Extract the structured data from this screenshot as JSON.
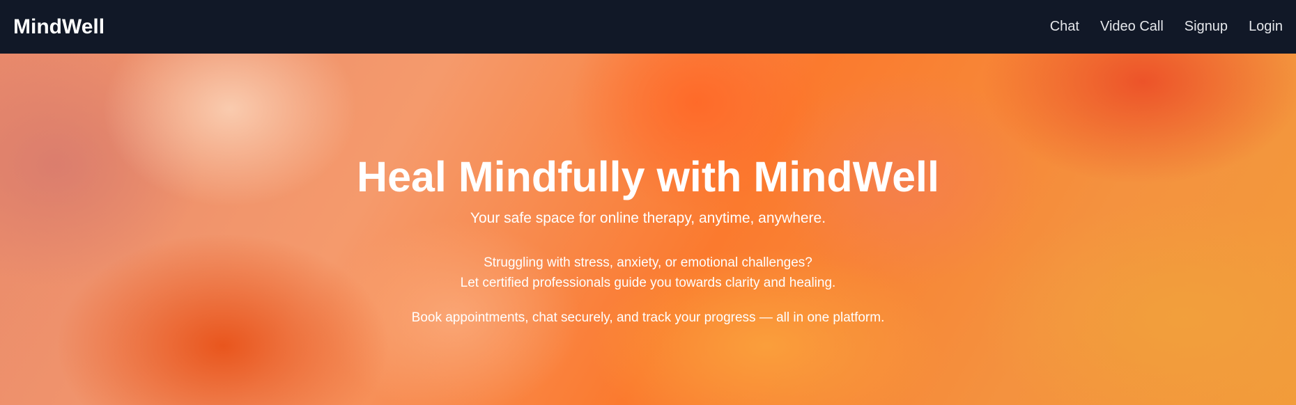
{
  "navbar": {
    "brand": "MindWell",
    "links": [
      {
        "label": "Chat"
      },
      {
        "label": "Video Call"
      },
      {
        "label": "Signup"
      },
      {
        "label": "Login"
      }
    ],
    "background": "#111827"
  },
  "hero": {
    "title": "Heal Mindfully with MindWell",
    "subtitle": "Your safe space for online therapy, anytime, anywhere.",
    "description_line_1": "Struggling with stress, anxiety, or emotional challenges?",
    "description_line_2": "Let certified professionals guide you towards clarity and healing.",
    "features_line": "Book appointments, chat securely, and track your progress — all in one platform.",
    "accent_color": "#f97316"
  }
}
